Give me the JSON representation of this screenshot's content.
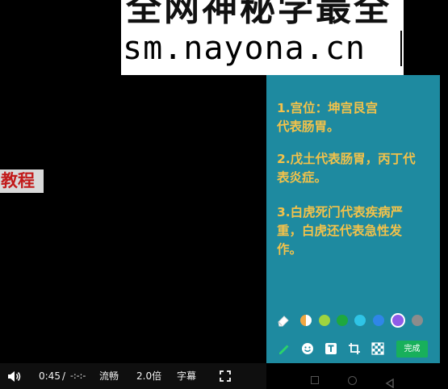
{
  "overlay": {
    "line1": "全网神秘学最全",
    "line2": "sm.nayona.cn"
  },
  "side_label": "教程",
  "notes": [
    "1.宫位：坤宫艮宫\n代表肠胃。",
    "2.戊土代表肠胃，丙丁代\n表炎症。",
    "3.白虎死门代表疾病严\n重，白虎还代表急性发\n作。"
  ],
  "colors": {
    "panel": "#1e8aa0",
    "note_text": "#f3c24a",
    "done_button": "#18b05b",
    "swatches": [
      "#f0a742",
      "#9ed43f",
      "#1ea83e",
      "#2fc4e6",
      "#2f86e8",
      "#8e5be8",
      "#8c8c8c"
    ]
  },
  "editor": {
    "done_label": "完成",
    "tools": [
      "pen-icon",
      "emoji-icon",
      "text-icon",
      "crop-icon",
      "mosaic-icon"
    ],
    "selected_color": "#8e5be8"
  },
  "player": {
    "current_time": "0:45",
    "separator": "/",
    "total_time": "-:-:-",
    "quality_label": "流畅",
    "speed_label": "2.0倍",
    "subtitle_label": "字幕"
  }
}
